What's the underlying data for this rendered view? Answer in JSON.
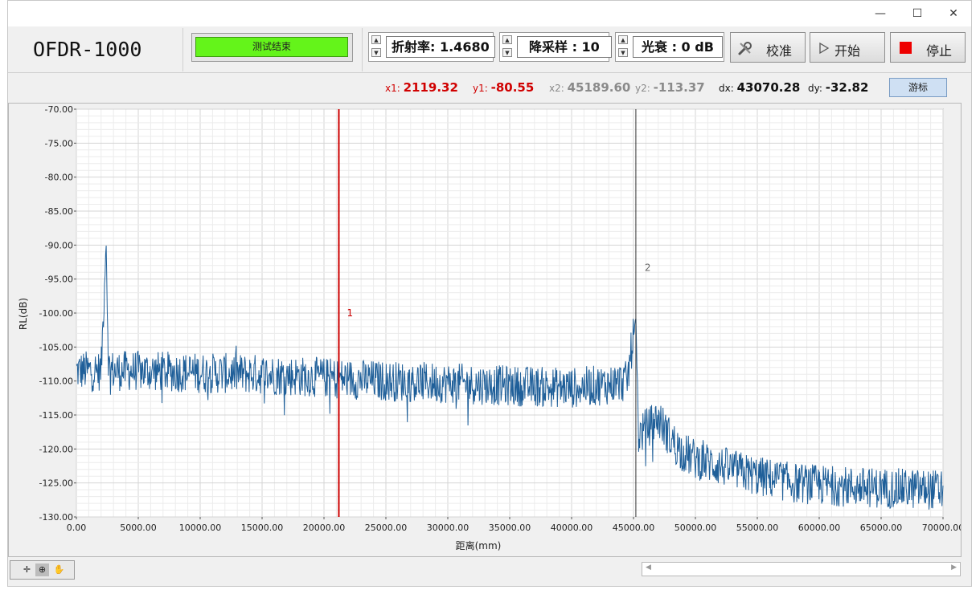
{
  "window": {
    "controls": {
      "minimize": "—",
      "maximize": "☐",
      "close": "✕"
    }
  },
  "app": {
    "title": "OFDR-1000"
  },
  "status": {
    "text": "测试结束",
    "color": "#64f41a"
  },
  "controls": {
    "refractive_index": {
      "label": "折射率: 1.4680"
    },
    "downsample": {
      "label": "降采样 : 10"
    },
    "attenuation": {
      "label": "光衰 : 0 dB"
    }
  },
  "buttons": {
    "calibrate": "校准",
    "start": "开始",
    "stop": "停止"
  },
  "cursors": {
    "x1_label": "x1:",
    "x1_value": "2119.32",
    "y1_label": "y1:",
    "y1_value": "-80.55",
    "x2_label": "x2:",
    "x2_value": "45189.60",
    "y2_label": "y2:",
    "y2_value": "-113.37",
    "dx_label": "dx:",
    "dx_value": "43070.28",
    "dy_label": "dy:",
    "dy_value": "-32.82",
    "cursor_button": "游标",
    "cursor1_name": "1",
    "cursor2_name": "2"
  },
  "chart_data": {
    "type": "line",
    "xlabel": "距离(mm)",
    "ylabel": "RL(dB)",
    "xlim": [
      0,
      70000
    ],
    "ylim": [
      -130,
      -70
    ],
    "x_ticks": [
      "0.00",
      "5000.00",
      "10000.00",
      "15000.00",
      "20000.00",
      "25000.00",
      "30000.00",
      "35000.00",
      "40000.00",
      "45000.00",
      "50000.00",
      "55000.00",
      "60000.00",
      "65000.00",
      "70000.00"
    ],
    "y_ticks": [
      "-70.00",
      "-75.00",
      "-80.00",
      "-85.00",
      "-90.00",
      "-95.00",
      "-100.00",
      "-105.00",
      "-110.00",
      "-115.00",
      "-120.00",
      "-125.00",
      "-130.00"
    ],
    "grid": true,
    "series_color": "#1f5f99",
    "cursor1_color": "#cc0000",
    "cursor2_color": "#333333",
    "cursor1_x": 21200,
    "cursor2_x": 45190,
    "series": [
      {
        "x": [
          0,
          2000,
          2400,
          2600,
          3000,
          5000,
          10000,
          15000,
          20000,
          25000,
          30000,
          35000,
          40000,
          43000,
          44500,
          45190,
          45400,
          46000,
          47000,
          48000,
          49000,
          50000,
          52000,
          55000,
          58000,
          60000,
          63000,
          66000,
          70000
        ],
        "y": [
          -108.5,
          -108.5,
          -89.5,
          -108,
          -108.5,
          -108.5,
          -108.8,
          -109,
          -109.5,
          -110,
          -110.3,
          -110.7,
          -111,
          -110.5,
          -110,
          -100.5,
          -118,
          -117,
          -115.5,
          -118.5,
          -120.5,
          -121.5,
          -122.5,
          -124,
          -125,
          -125.3,
          -125.6,
          -125.8,
          -126
        ],
        "noise_band_db": 3
      }
    ]
  },
  "tools": {
    "crosshair": "✛",
    "zoom": "⊕",
    "pan": "✋"
  },
  "scroll": {
    "left": "◀",
    "right": "▶"
  }
}
